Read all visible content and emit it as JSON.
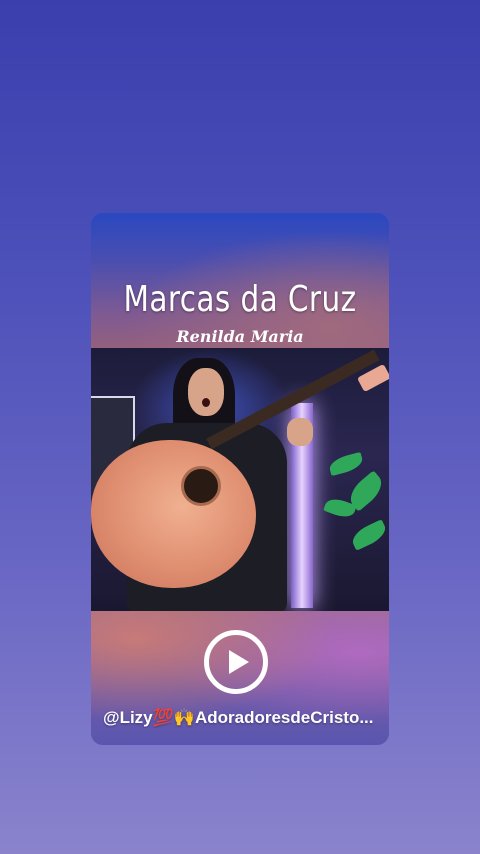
{
  "post": {
    "title": "Marcas da Cruz",
    "subtitle": "Renilda Maria",
    "caption": "@Lizy💯🙌AdoradoresdeCristo...",
    "play_icon": "play-icon"
  },
  "colors": {
    "background_top": "#3b3fae",
    "background_bottom": "#8a83cc",
    "text": "#ffffff"
  }
}
